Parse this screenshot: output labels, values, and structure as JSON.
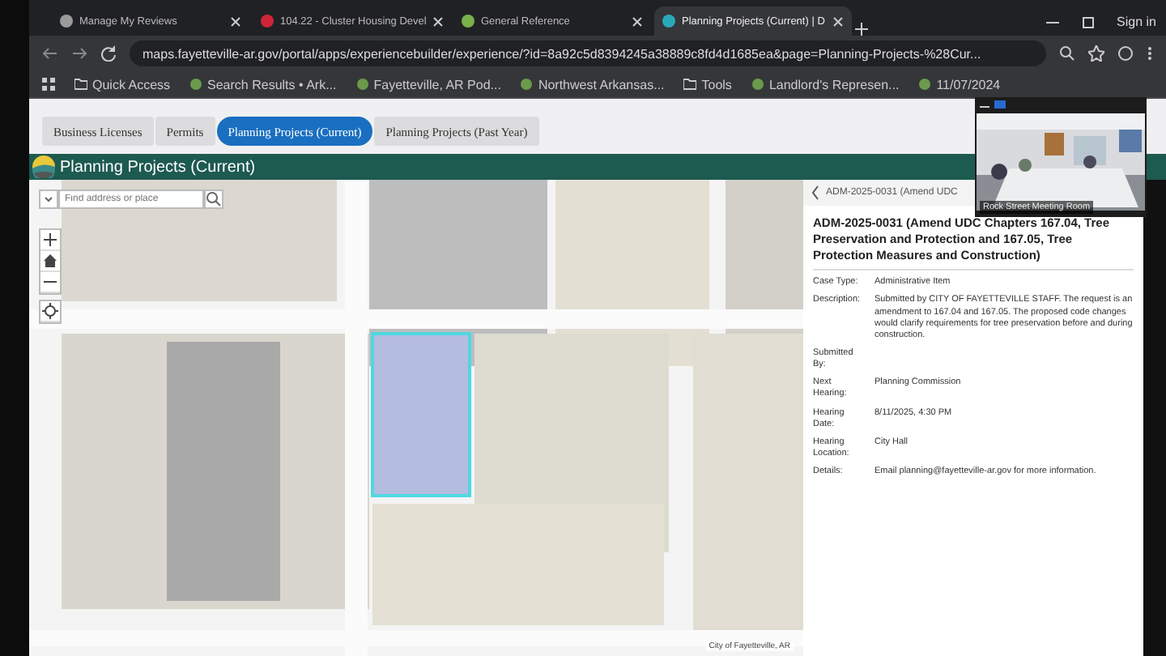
{
  "browser": {
    "tabs": [
      {
        "title": "Manage My Reviews",
        "selected": false,
        "color": "#9a9a9a"
      },
      {
        "title": "104.22 - Cluster Housing Devel",
        "selected": false,
        "color": "#d0243a"
      },
      {
        "title": "General Reference",
        "selected": false,
        "color": "#7ab04a"
      },
      {
        "title": "Planning Projects (Current) | D",
        "selected": true,
        "color": "#2aa8b8"
      }
    ],
    "url": "maps.fayetteville-ar.gov/portal/apps/experiencebuilder/experience/?id=8a92c5d8394245a38889c8fd4d1685ea&page=Planning-Projects-%28Cur...",
    "sign_in": "Sign in",
    "bookmarks": [
      {
        "label": "Quick Access",
        "kind": "folder"
      },
      {
        "label": "Search Results • Ark...",
        "kind": "site"
      },
      {
        "label": "Fayetteville, AR Pod...",
        "kind": "site"
      },
      {
        "label": "Northwest Arkansas...",
        "kind": "site"
      },
      {
        "label": "Tools",
        "kind": "folder"
      },
      {
        "label": "Landlord's Represen...",
        "kind": "site"
      },
      {
        "label": "11/07/2024",
        "kind": "site"
      }
    ]
  },
  "app": {
    "tabs": [
      {
        "label": "Business Licenses",
        "selected": false
      },
      {
        "label": "Permits",
        "selected": false
      },
      {
        "label": "Planning Projects (Current)",
        "selected": true
      },
      {
        "label": "Planning Projects (Past Year)",
        "selected": false
      }
    ],
    "title": "Planning Projects (Current)",
    "map": {
      "search": {
        "placeholder": "Find address or place"
      },
      "attribution": "City of Fayetteville, AR"
    },
    "panel": {
      "header": "ADM-2025-0031 (Amend UDC",
      "title": "ADM-2025-0031 (Amend UDC Chapters 167.04, Tree Preservation and Protection and 167.05, Tree Protection Measures and Construction)",
      "fields": [
        {
          "label": "Case Type:",
          "value": "Administrative Item"
        },
        {
          "label": "Description:",
          "value": "Submitted by CITY OF FAYETTEVILLE STAFF. The request is an amendment to 167.04 and 167.05. The proposed code changes would clarify requirements for tree preservation before and during construction."
        },
        {
          "label": "Submitted By:"
        },
        {
          "label": "Next Hearing:",
          "value": "Planning Commission"
        },
        {
          "label": "Hearing Date:",
          "value": "8/11/2025, 4:30 PM"
        },
        {
          "label": "Hearing Location:",
          "value": "City Hall"
        },
        {
          "label": "Details:",
          "value": "Email planning@fayetteville-ar.gov for more information."
        }
      ]
    }
  },
  "video": {
    "caption": "Rock Street Meeting Room"
  }
}
